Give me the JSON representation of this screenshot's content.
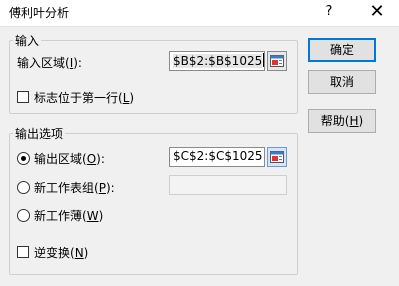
{
  "window": {
    "title": "傅利叶分析",
    "help_glyph": "?",
    "close_glyph": "✕"
  },
  "input_group": {
    "label": "输入",
    "range_label": "输入区域(",
    "range_key": "I",
    "range_suffix": "):",
    "range_value": "$B$2:$B$1025",
    "headers_label": "标志位于第一行(",
    "headers_key": "L",
    "headers_suffix": ")",
    "headers_checked": false
  },
  "output_group": {
    "label": "输出选项",
    "output_range_label": "输出区域(",
    "output_range_key": "O",
    "output_range_suffix": "):",
    "output_range_value": "$C$2:$C$1025",
    "output_range_selected": true,
    "new_sheet_label": "新工作表组(",
    "new_sheet_key": "P",
    "new_sheet_suffix": "):",
    "new_sheet_value": "",
    "new_workbook_label": "新工作薄(",
    "new_workbook_key": "W",
    "new_workbook_suffix": ")",
    "inverse_label": "逆变换(",
    "inverse_key": "N",
    "inverse_suffix": ")",
    "inverse_checked": false
  },
  "buttons": {
    "ok_label": "确定",
    "cancel_label": "取消",
    "help_prefix": "帮助(",
    "help_key": "H",
    "help_suffix": ")"
  },
  "icons": {
    "collapse_dialog": "range-selector-icon"
  },
  "colors": {
    "accent": "#0078d7",
    "dialog_bg": "#f0f0f0"
  }
}
